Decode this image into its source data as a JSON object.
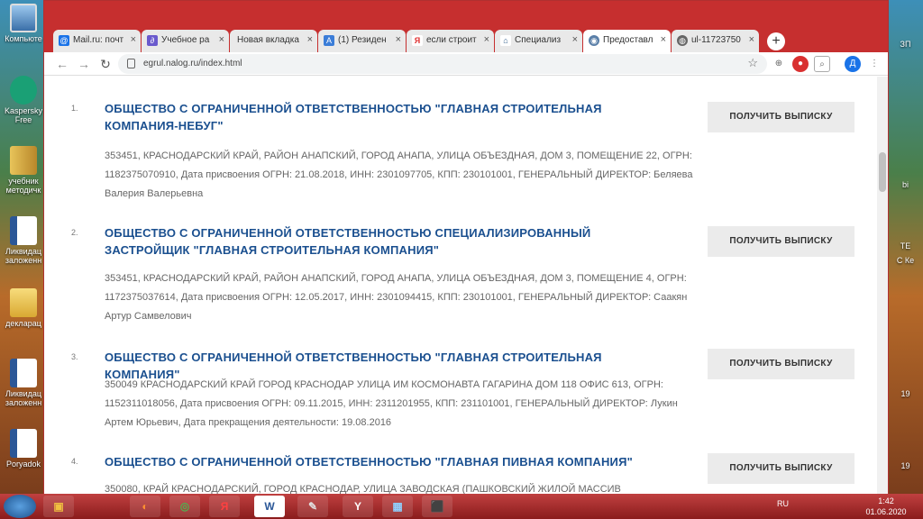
{
  "desktop": {
    "icons": [
      {
        "label": "Компьюте"
      },
      {
        "label": "Kaspersky Free"
      },
      {
        "label": "учебник методичк"
      },
      {
        "label": "Ликвидац заложенн"
      },
      {
        "label": "декларац"
      },
      {
        "label": "Ликвидац заложенн"
      },
      {
        "label": "Poryadok"
      }
    ],
    "right_labels": [
      "ЗП",
      "bi",
      "ТЕ",
      "С Ке",
      "19",
      "19"
    ]
  },
  "browser": {
    "tabs": [
      {
        "label": "Mail.ru: почт",
        "icon": "mail-icon",
        "color": "#1a73e8"
      },
      {
        "label": "Учебное ра",
        "icon": "clip-icon",
        "color": "#6a5acd"
      },
      {
        "label": "Новая вкладка",
        "icon": "",
        "color": "#e9e9e9"
      },
      {
        "label": "(1) Резиден",
        "icon": "a-icon",
        "color": "#3b7dd8"
      },
      {
        "label": "если строит",
        "icon": "yandex-icon",
        "color": "#e03030"
      },
      {
        "label": "Специализ",
        "icon": "home-icon",
        "color": "#2d5a88"
      },
      {
        "label": "Предоставл",
        "icon": "fns-icon",
        "color": "#5a7fa8"
      },
      {
        "label": "ul-11723750",
        "icon": "globe-icon",
        "color": "#666666"
      }
    ],
    "url": "egrul.nalog.ru/index.html",
    "profile_initial": "Д"
  },
  "results": [
    {
      "num": "1.",
      "name": "ОБЩЕСТВО С ОГРАНИЧЕННОЙ ОТВЕТСТВЕННОСТЬЮ \"ГЛАВНАЯ СТРОИТЕЛЬНАЯ КОМПАНИЯ-НЕБУГ\"",
      "details": "353451, КРАСНОДАРСКИЙ КРАЙ, РАЙОН АНАПСКИЙ, ГОРОД АНАПА, УЛИЦА ОБЪЕЗДНАЯ, ДОМ 3, ПОМЕЩЕНИЕ 22, ОГРН: 1182375070910, Дата присвоения ОГРН: 21.08.2018, ИНН: 2301097705, КПП: 230101001, ГЕНЕРАЛЬНЫЙ ДИРЕКТОР: Беляева Валерия Валерьевна",
      "button": "ПОЛУЧИТЬ ВЫПИСКУ"
    },
    {
      "num": "2.",
      "name": "ОБЩЕСТВО С ОГРАНИЧЕННОЙ ОТВЕТСТВЕННОСТЬЮ СПЕЦИАЛИЗИРОВАННЫЙ ЗАСТРОЙЩИК \"ГЛАВНАЯ СТРОИТЕЛЬНАЯ КОМПАНИЯ\"",
      "details": "353451, КРАСНОДАРСКИЙ КРАЙ, РАЙОН АНАПСКИЙ, ГОРОД АНАПА, УЛИЦА ОБЪЕЗДНАЯ, ДОМ 3, ПОМЕЩЕНИЕ 4, ОГРН: 1172375037614, Дата присвоения ОГРН: 12.05.2017, ИНН: 2301094415, КПП: 230101001, ГЕНЕРАЛЬНЫЙ ДИРЕКТОР: Саакян Артур Самвелович",
      "button": "ПОЛУЧИТЬ ВЫПИСКУ"
    },
    {
      "num": "3.",
      "name": "ОБЩЕСТВО С ОГРАНИЧЕННОЙ ОТВЕТСТВЕННОСТЬЮ \"ГЛАВНАЯ СТРОИТЕЛЬНАЯ КОМПАНИЯ\"",
      "details": "350049 КРАСНОДАРСКИЙ КРАЙ ГОРОД КРАСНОДАР УЛИЦА ИМ КОСМОНАВТА ГАГАРИНА ДОМ 118 ОФИС 613, ОГРН: 1152311018056, Дата присвоения ОГРН: 09.11.2015, ИНН: 2311201955, КПП: 231101001, ГЕНЕРАЛЬНЫЙ ДИРЕКТОР: Лукин Артем Юрьевич, Дата прекращения деятельности: 19.08.2016",
      "button": "ПОЛУЧИТЬ ВЫПИСКУ"
    },
    {
      "num": "4.",
      "name": "ОБЩЕСТВО С ОГРАНИЧЕННОЙ ОТВЕТСТВЕННОСТЬЮ \"ГЛАВНАЯ ПИВНАЯ КОМПАНИЯ\"",
      "details": "350080, КРАЙ КРАСНОДАРСКИЙ, ГОРОД КРАСНОДАР, УЛИЦА ЗАВОДСКАЯ (ПАШКОВСКИЙ ЖИЛОЙ МАССИВ",
      "button": "ПОЛУЧИТЬ ВЫПИСКУ"
    }
  ],
  "taskbar": {
    "lang": "RU",
    "time": "1:42",
    "date": "01.06.2020",
    "apps": [
      "media-icon",
      "firefox-icon",
      "chrome-icon",
      "yandex-icon",
      "word-icon",
      "paint-icon",
      "yandex-browser-icon",
      "remote-icon",
      "pdf-icon"
    ]
  },
  "colors": {
    "chrome_frame": "#c62f2f",
    "link": "#1a4f8f",
    "button_bg": "#ebebeb"
  }
}
